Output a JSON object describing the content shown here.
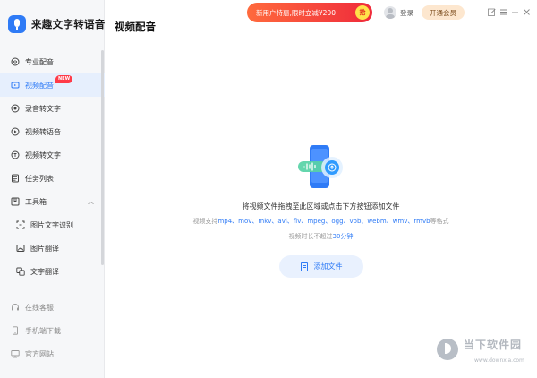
{
  "app": {
    "name": "来趣文字转语音"
  },
  "sidebar": {
    "items": [
      {
        "label": "专业配音",
        "icon": "professional-dub-icon"
      },
      {
        "label": "视频配音",
        "icon": "video-dub-icon",
        "active": true,
        "badge": "NEW"
      },
      {
        "label": "录音转文字",
        "icon": "record-to-text-icon"
      },
      {
        "label": "视频转语音",
        "icon": "video-to-audio-icon"
      },
      {
        "label": "视频转文字",
        "icon": "video-to-text-icon"
      },
      {
        "label": "任务列表",
        "icon": "task-list-icon"
      },
      {
        "label": "工具箱",
        "icon": "toolbox-icon",
        "expanded": true
      },
      {
        "label": "图片文字识别",
        "icon": "image-ocr-icon",
        "sub": true
      },
      {
        "label": "图片翻译",
        "icon": "image-translate-icon",
        "sub": true
      },
      {
        "label": "文字翻译",
        "icon": "text-translate-icon",
        "sub": true
      }
    ],
    "bottom_items": [
      {
        "label": "在线客服",
        "icon": "headset-icon"
      },
      {
        "label": "手机端下载",
        "icon": "phone-icon"
      },
      {
        "label": "官方网站",
        "icon": "monitor-icon"
      }
    ]
  },
  "header": {
    "title": "视频配音",
    "promo_text": "新用户特惠,限时立减¥200",
    "promo_badge": "抢",
    "login_label": "登录",
    "vip_label": "开通会员"
  },
  "main": {
    "drop_hint": "将视频文件拖拽至此区域或点击下方按钮添加文件",
    "formats_prefix": "视频支持",
    "formats": "mp4、mov、mkv、avi、flv、mpeg、ogg、vob、webm、wmv、rmvb",
    "formats_suffix": "等格式",
    "duration_prefix": "视频时长不超过",
    "duration_value": "30分钟",
    "add_button": "添加文件"
  },
  "watermark": {
    "text": "当下软件园",
    "url": "www.downxia.com"
  },
  "colors": {
    "accent": "#2f7bf6",
    "promo": "#ef2b3b",
    "badge": "#ff3b48",
    "vip": "#fde7cf"
  }
}
